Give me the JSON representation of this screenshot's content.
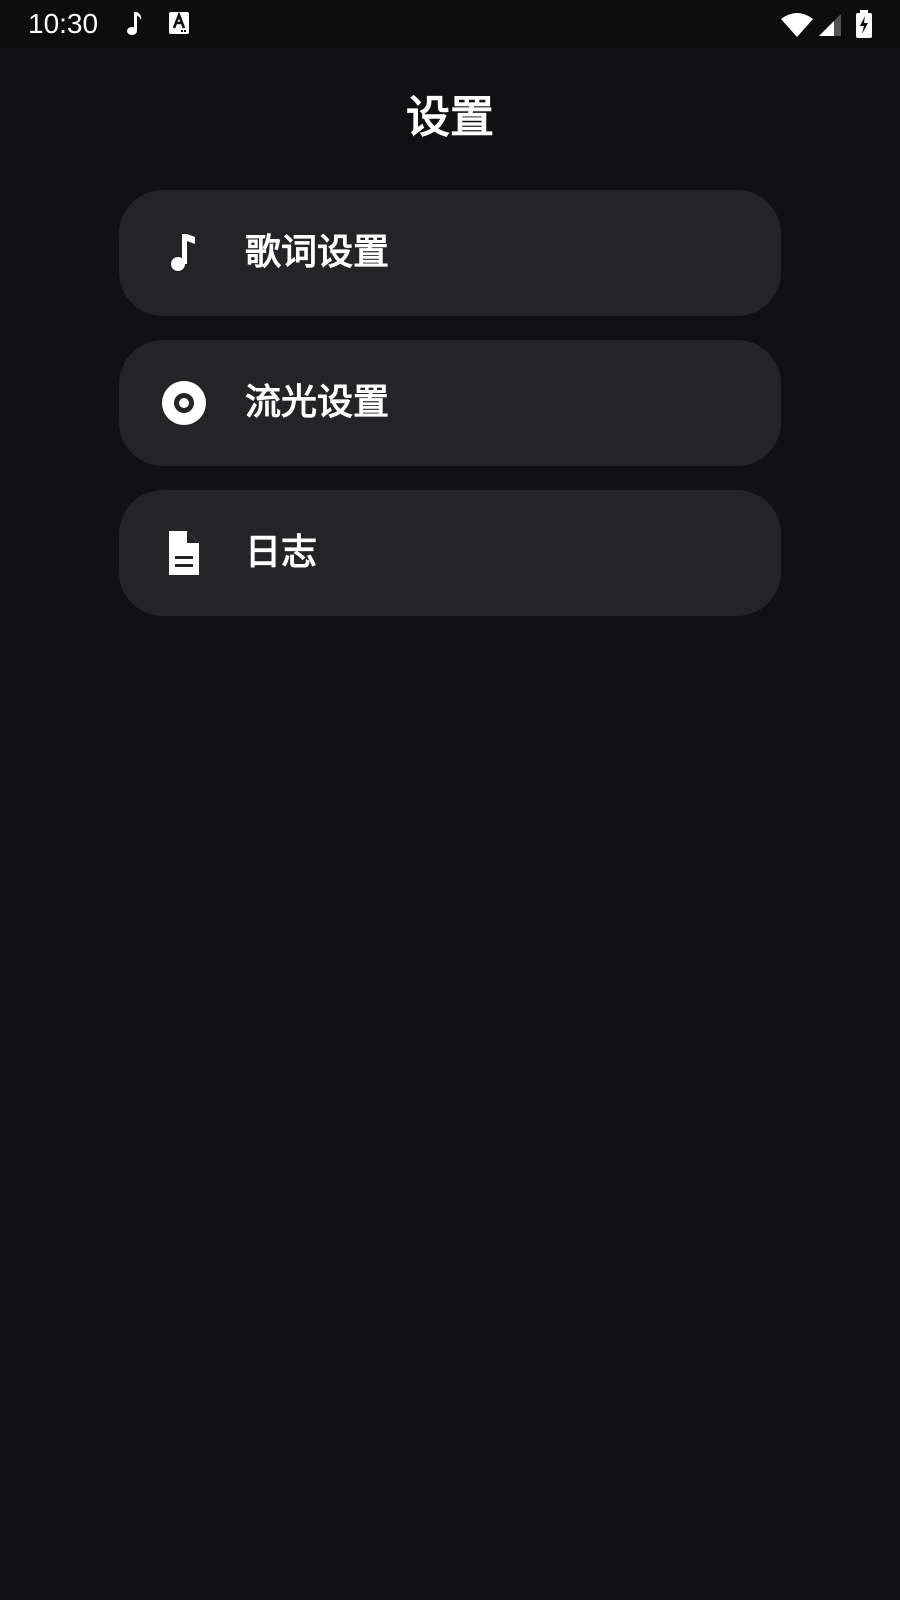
{
  "status_bar": {
    "time": "10:30",
    "icons": [
      "music-note-icon",
      "font-a-icon",
      "wifi-icon",
      "cell-signal-icon",
      "battery-charging-icon"
    ]
  },
  "page": {
    "title": "设置"
  },
  "menu": {
    "items": [
      {
        "label": "歌词设置",
        "icon": "music-note-icon"
      },
      {
        "label": "流光设置",
        "icon": "disc-icon"
      },
      {
        "label": "日志",
        "icon": "document-icon"
      }
    ]
  },
  "colors": {
    "background": "#111113",
    "card": "#242427",
    "text": "#ffffff"
  }
}
